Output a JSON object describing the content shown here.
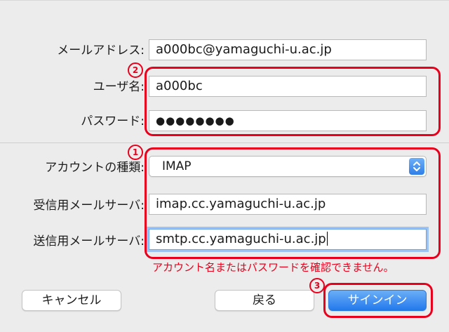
{
  "form": {
    "email_label": "メールアドレス:",
    "email_value": "a000bc@yamaguchi-u.ac.jp",
    "username_label": "ユーザ名:",
    "username_value": "a000bc",
    "password_label": "パスワード:",
    "password_value": "●●●●●●●●",
    "account_type_label": "アカウントの種類:",
    "account_type_value": "IMAP",
    "incoming_label": "受信用メールサーバ:",
    "incoming_value": "imap.cc.yamaguchi-u.ac.jp",
    "outgoing_label": "送信用メールサーバ:",
    "outgoing_value": "smtp.cc.yamaguchi-u.ac.jp",
    "error_message": "アカウント名またはパスワードを確認できません。"
  },
  "buttons": {
    "cancel": "キャンセル",
    "back": "戻る",
    "signin": "サインイン"
  },
  "annotations": {
    "badge_1": "1",
    "badge_2": "2",
    "badge_3": "3",
    "color": "#e8001c"
  },
  "icons": {
    "select_arrows": "up-down-chevron-icon"
  }
}
